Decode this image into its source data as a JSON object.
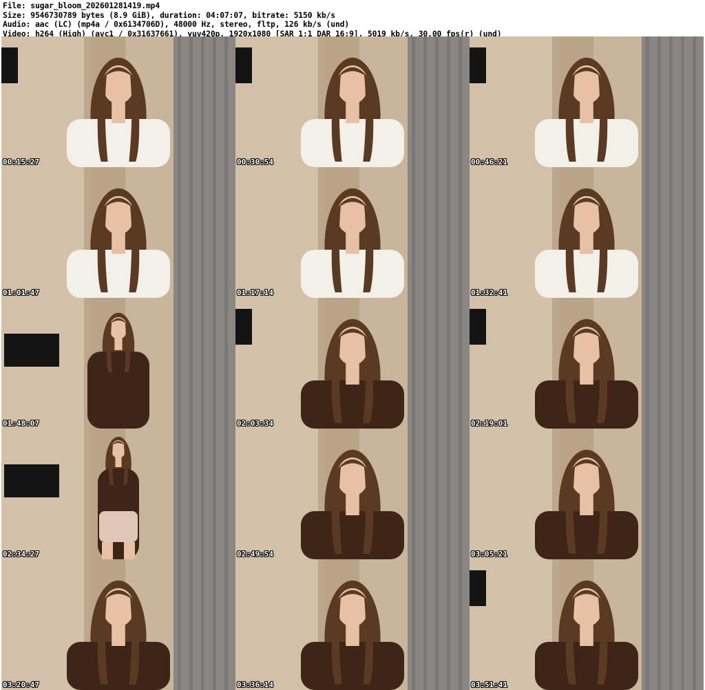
{
  "header": {
    "file": "File: sugar_bloom_202601281419.mp4",
    "size": "Size: 9546730789 bytes (8.9 GiB), duration: 04:07:07, bitrate: 5150 kb/s",
    "audio": "Audio: aac (LC) (mp4a / 0x6134706D), 48000 Hz, stereo, fltp, 126 kb/s (und)",
    "video": "Video: h264 (High) (avc1 / 0x31637661), yuv420p, 1920x1080 [SAR 1:1 DAR 16:9], 5019 kb/s, 30.00 fps(r) (und)"
  },
  "thumbnails": [
    {
      "timestamp": "00:15:27",
      "top": "white-blouse",
      "scene": "close",
      "tv": true
    },
    {
      "timestamp": "00:30:54",
      "top": "white-blouse",
      "scene": "close",
      "tv": true
    },
    {
      "timestamp": "00:46:21",
      "top": "white-blouse",
      "scene": "close",
      "tv": true
    },
    {
      "timestamp": "01:01:47",
      "top": "white-blouse",
      "scene": "close",
      "tv": false
    },
    {
      "timestamp": "01:17:14",
      "top": "white-blouse",
      "scene": "close",
      "tv": false
    },
    {
      "timestamp": "01:32:41",
      "top": "white-blouse",
      "scene": "close",
      "tv": false
    },
    {
      "timestamp": "01:48:07",
      "top": "brown-tee",
      "scene": "wide",
      "tv": true
    },
    {
      "timestamp": "02:03:34",
      "top": "brown-tee",
      "scene": "close",
      "tv": true
    },
    {
      "timestamp": "02:19:01",
      "top": "brown-tee",
      "scene": "close",
      "tv": true
    },
    {
      "timestamp": "02:34:27",
      "top": "brown-tee",
      "scene": "full",
      "tv": true
    },
    {
      "timestamp": "02:49:54",
      "top": "brown-tee",
      "scene": "close",
      "tv": false
    },
    {
      "timestamp": "03:05:21",
      "top": "brown-tee",
      "scene": "close",
      "tv": false
    },
    {
      "timestamp": "03:20:47",
      "top": "brown-tee",
      "scene": "close",
      "tv": false
    },
    {
      "timestamp": "03:36:14",
      "top": "brown-tee",
      "scene": "close",
      "tv": false
    },
    {
      "timestamp": "03:51:41",
      "top": "brown-tee",
      "scene": "close",
      "tv": true
    }
  ],
  "colors": {
    "background": "#ffffff",
    "wall": "#c9b59c",
    "curtain": "#8a8683",
    "hair": "#5a3a22",
    "skin": "#e8c1a4",
    "white_top": "#f3efe9",
    "brown_top": "#3e2518",
    "tv": "#141414"
  }
}
